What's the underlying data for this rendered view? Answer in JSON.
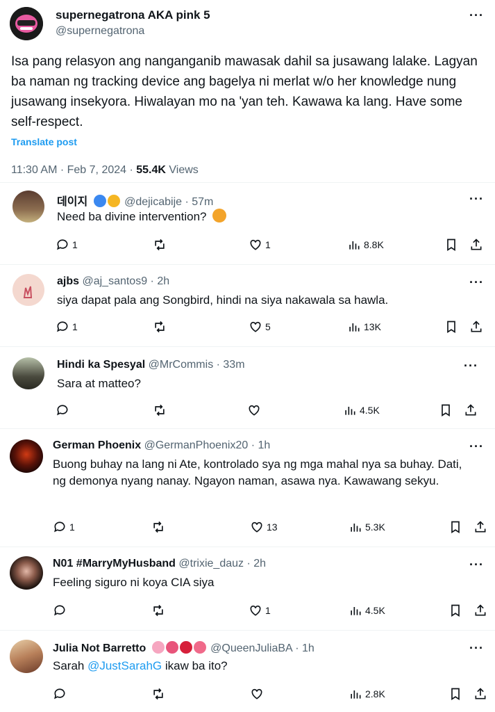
{
  "main_post": {
    "display_name": "supernegatrona AKA pink 5",
    "handle": "@supernegatrona",
    "text": "Isa pang relasyon ang nanganganib mawasak dahil sa jusawang lalake. Lagyan ba naman ng tracking device ang bagelya ni merlat w/o her knowledge nung jusawang insekyora. Hiwalayan mo na 'yan teh. Kawawa ka lang. Have some self-respect.",
    "translate": "Translate post",
    "time": "11:30 AM · Feb 7, 2024 · ",
    "views_count": "55.4K",
    "views_label": " Views"
  },
  "replies": [
    {
      "name": "데이지",
      "handle": "@dejicabije · 57m",
      "text": "Need ba divine intervention?",
      "replies": "1",
      "reposts": "",
      "likes": "1",
      "views": "8.8K"
    },
    {
      "name": "ajbs",
      "handle": "@aj_santos9 · 2h",
      "text": "siya dapat pala ang Songbird,  hindi na siya nakawala sa hawla.",
      "replies": "1",
      "reposts": "",
      "likes": "5",
      "views": "13K"
    },
    {
      "name": "Hindi ka Spesyal",
      "handle": "@MrCommis · 33m",
      "text": "Sara at matteo?",
      "replies": "",
      "reposts": "",
      "likes": "",
      "views": "4.5K"
    },
    {
      "name": "German Phoenix",
      "handle": "@GermanPhoenix20 · 1h",
      "text": "Buong buhay na lang ni Ate, kontrolado sya ng mga mahal nya sa buhay. Dati, ng demonya nyang nanay. Ngayon naman, asawa nya. Kawawang sekyu.",
      "replies": "1",
      "reposts": "",
      "likes": "13",
      "views": "5.3K"
    },
    {
      "name": "N01 #MarryMyHusband",
      "handle": "@trixie_dauz · 2h",
      "text": "Feeling siguro ni koya CIA siya",
      "replies": "",
      "reposts": "",
      "likes": "1",
      "views": "4.5K"
    },
    {
      "name": "Julia Not Barretto",
      "handle": "@QueenJuliaBA · 1h",
      "text_prefix": "Sarah ",
      "mention": "@JustSarahG",
      "text_suffix": " ikaw ba ito?",
      "replies": "",
      "reposts": "",
      "likes": "",
      "views": "2.8K"
    }
  ],
  "more_glyph": "···",
  "colors": {
    "link": "#1d9bf0",
    "text": "#0f1419",
    "secondary": "#536471",
    "divider": "#eff3f4"
  }
}
